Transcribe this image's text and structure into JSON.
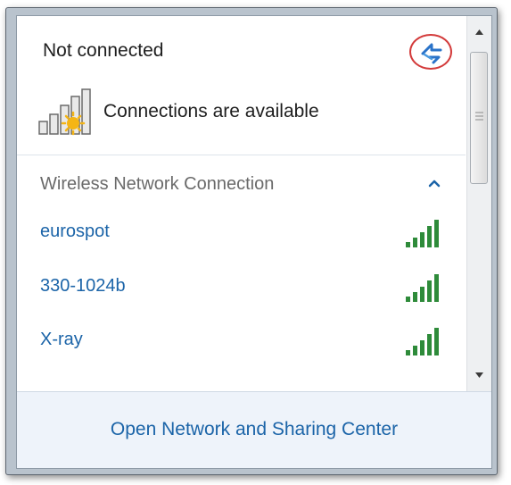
{
  "status": {
    "title": "Not connected",
    "detail": "Connections are available"
  },
  "section": {
    "label": "Wireless Network Connection"
  },
  "networks": [
    {
      "name": "eurospot"
    },
    {
      "name": "330-1024b"
    },
    {
      "name": "X-ray"
    }
  ],
  "footer": {
    "link_label": "Open Network and Sharing Center"
  },
  "colors": {
    "link": "#1b64a8",
    "signal_green": "#2e8b3a",
    "highlight_red": "#d33a3a",
    "footer_bg": "#eef3fa"
  }
}
